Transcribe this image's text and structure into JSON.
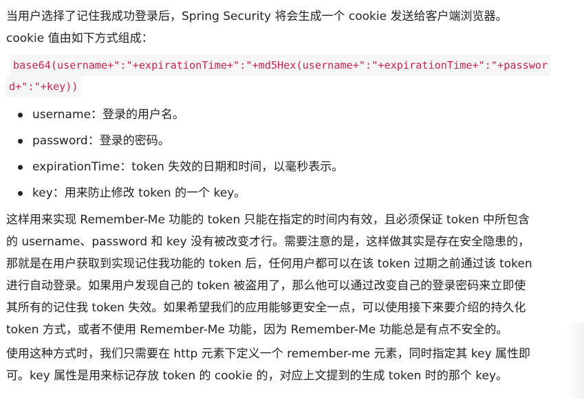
{
  "intro": {
    "line1": "当用户选择了记住我成功登录后，Spring Security 将会生成一个 cookie 发送给客户端浏览器。",
    "line2": "cookie 值由如下方式组成："
  },
  "code": {
    "line1": "base64(username+\":\"+expirationTime+\":\"+md5Hex(username+\":\"+expirationTime+\":\"+passwor",
    "line2": "d+\":\"+key))"
  },
  "bullets": [
    {
      "text": "username：登录的用户名。"
    },
    {
      "text": "password：登录的密码。"
    },
    {
      "text": "expirationTime：token 失效的日期和时间，以毫秒表示。"
    },
    {
      "text": "key：用来防止修改 token 的一个 key。"
    }
  ],
  "para2": {
    "lines": [
      "这样用来实现 Remember-Me 功能的 token 只能在指定的时间内有效，且必须保证 token 中所包含",
      "的 username、password 和 key 没有被改变才行。需要注意的是，这样做其实是存在安全隐患的，",
      "那就是在用户获取到实现记住我功能的 token 后，任何用户都可以在该 token 过期之前通过该 token",
      "进行自动登录。如果用户发现自己的 token 被盗用了，那么他可以通过改变自己的登录密码来立即使",
      "其所有的记住我 token 失效。如果希望我们的应用能够更安全一点，可以使用接下来要介绍的持久化",
      "token 方式，或者不使用 Remember-Me 功能，因为 Remember-Me 功能总是有点不安全的。"
    ]
  },
  "para3": {
    "lines": [
      "使用这种方式时，我们只需要在 http 元素下定义一个 remember-me 元素，同时指定其 key 属性即",
      "可。key 属性是用来标记存放 token 的 cookie 的，对应上文提到的生成 token 时的那个 key。"
    ]
  }
}
